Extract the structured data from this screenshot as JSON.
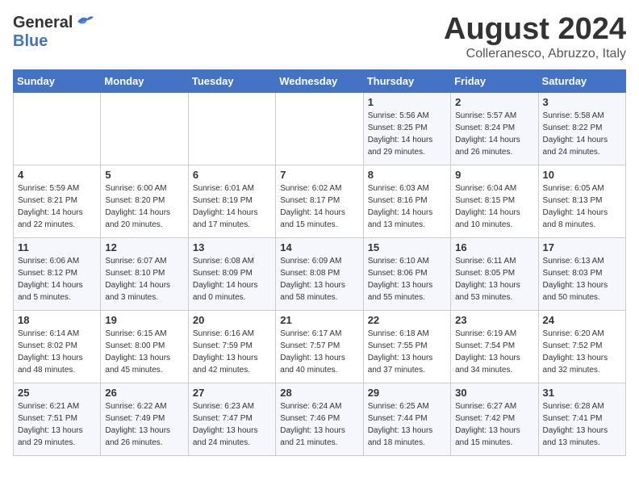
{
  "header": {
    "logo_general": "General",
    "logo_blue": "Blue",
    "month": "August 2024",
    "location": "Colleranesco, Abruzzo, Italy"
  },
  "weekdays": [
    "Sunday",
    "Monday",
    "Tuesday",
    "Wednesday",
    "Thursday",
    "Friday",
    "Saturday"
  ],
  "weeks": [
    [
      {
        "day": "",
        "info": ""
      },
      {
        "day": "",
        "info": ""
      },
      {
        "day": "",
        "info": ""
      },
      {
        "day": "",
        "info": ""
      },
      {
        "day": "1",
        "info": "Sunrise: 5:56 AM\nSunset: 8:25 PM\nDaylight: 14 hours\nand 29 minutes."
      },
      {
        "day": "2",
        "info": "Sunrise: 5:57 AM\nSunset: 8:24 PM\nDaylight: 14 hours\nand 26 minutes."
      },
      {
        "day": "3",
        "info": "Sunrise: 5:58 AM\nSunset: 8:22 PM\nDaylight: 14 hours\nand 24 minutes."
      }
    ],
    [
      {
        "day": "4",
        "info": "Sunrise: 5:59 AM\nSunset: 8:21 PM\nDaylight: 14 hours\nand 22 minutes."
      },
      {
        "day": "5",
        "info": "Sunrise: 6:00 AM\nSunset: 8:20 PM\nDaylight: 14 hours\nand 20 minutes."
      },
      {
        "day": "6",
        "info": "Sunrise: 6:01 AM\nSunset: 8:19 PM\nDaylight: 14 hours\nand 17 minutes."
      },
      {
        "day": "7",
        "info": "Sunrise: 6:02 AM\nSunset: 8:17 PM\nDaylight: 14 hours\nand 15 minutes."
      },
      {
        "day": "8",
        "info": "Sunrise: 6:03 AM\nSunset: 8:16 PM\nDaylight: 14 hours\nand 13 minutes."
      },
      {
        "day": "9",
        "info": "Sunrise: 6:04 AM\nSunset: 8:15 PM\nDaylight: 14 hours\nand 10 minutes."
      },
      {
        "day": "10",
        "info": "Sunrise: 6:05 AM\nSunset: 8:13 PM\nDaylight: 14 hours\nand 8 minutes."
      }
    ],
    [
      {
        "day": "11",
        "info": "Sunrise: 6:06 AM\nSunset: 8:12 PM\nDaylight: 14 hours\nand 5 minutes."
      },
      {
        "day": "12",
        "info": "Sunrise: 6:07 AM\nSunset: 8:10 PM\nDaylight: 14 hours\nand 3 minutes."
      },
      {
        "day": "13",
        "info": "Sunrise: 6:08 AM\nSunset: 8:09 PM\nDaylight: 14 hours\nand 0 minutes."
      },
      {
        "day": "14",
        "info": "Sunrise: 6:09 AM\nSunset: 8:08 PM\nDaylight: 13 hours\nand 58 minutes."
      },
      {
        "day": "15",
        "info": "Sunrise: 6:10 AM\nSunset: 8:06 PM\nDaylight: 13 hours\nand 55 minutes."
      },
      {
        "day": "16",
        "info": "Sunrise: 6:11 AM\nSunset: 8:05 PM\nDaylight: 13 hours\nand 53 minutes."
      },
      {
        "day": "17",
        "info": "Sunrise: 6:13 AM\nSunset: 8:03 PM\nDaylight: 13 hours\nand 50 minutes."
      }
    ],
    [
      {
        "day": "18",
        "info": "Sunrise: 6:14 AM\nSunset: 8:02 PM\nDaylight: 13 hours\nand 48 minutes."
      },
      {
        "day": "19",
        "info": "Sunrise: 6:15 AM\nSunset: 8:00 PM\nDaylight: 13 hours\nand 45 minutes."
      },
      {
        "day": "20",
        "info": "Sunrise: 6:16 AM\nSunset: 7:59 PM\nDaylight: 13 hours\nand 42 minutes."
      },
      {
        "day": "21",
        "info": "Sunrise: 6:17 AM\nSunset: 7:57 PM\nDaylight: 13 hours\nand 40 minutes."
      },
      {
        "day": "22",
        "info": "Sunrise: 6:18 AM\nSunset: 7:55 PM\nDaylight: 13 hours\nand 37 minutes."
      },
      {
        "day": "23",
        "info": "Sunrise: 6:19 AM\nSunset: 7:54 PM\nDaylight: 13 hours\nand 34 minutes."
      },
      {
        "day": "24",
        "info": "Sunrise: 6:20 AM\nSunset: 7:52 PM\nDaylight: 13 hours\nand 32 minutes."
      }
    ],
    [
      {
        "day": "25",
        "info": "Sunrise: 6:21 AM\nSunset: 7:51 PM\nDaylight: 13 hours\nand 29 minutes."
      },
      {
        "day": "26",
        "info": "Sunrise: 6:22 AM\nSunset: 7:49 PM\nDaylight: 13 hours\nand 26 minutes."
      },
      {
        "day": "27",
        "info": "Sunrise: 6:23 AM\nSunset: 7:47 PM\nDaylight: 13 hours\nand 24 minutes."
      },
      {
        "day": "28",
        "info": "Sunrise: 6:24 AM\nSunset: 7:46 PM\nDaylight: 13 hours\nand 21 minutes."
      },
      {
        "day": "29",
        "info": "Sunrise: 6:25 AM\nSunset: 7:44 PM\nDaylight: 13 hours\nand 18 minutes."
      },
      {
        "day": "30",
        "info": "Sunrise: 6:27 AM\nSunset: 7:42 PM\nDaylight: 13 hours\nand 15 minutes."
      },
      {
        "day": "31",
        "info": "Sunrise: 6:28 AM\nSunset: 7:41 PM\nDaylight: 13 hours\nand 13 minutes."
      }
    ]
  ]
}
